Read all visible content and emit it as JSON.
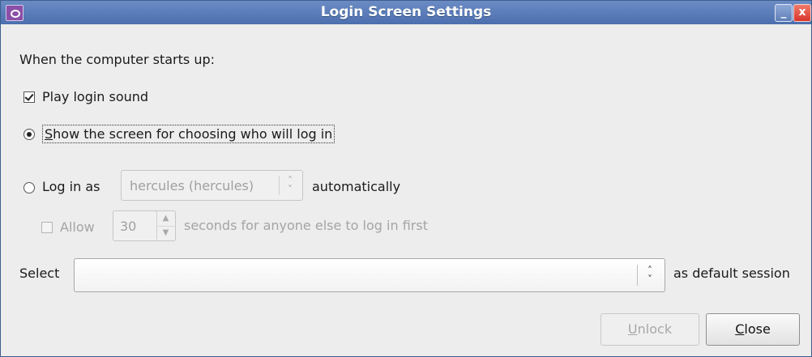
{
  "window": {
    "title": "Login Screen Settings",
    "minimize_glyph": "_",
    "close_glyph": "x",
    "app_icon": "login-settings-icon"
  },
  "intro": "When the computer starts up:",
  "options": {
    "play_login_sound": {
      "label": "Play login sound",
      "checked": true
    },
    "show_chooser": {
      "mnemonic": "S",
      "label_rest": "how the screen for choosing who will log in",
      "selected": true
    },
    "login_as": {
      "label": "Log in as",
      "user_value": "hercules (hercules)",
      "suffix": "automatically",
      "selected": false
    },
    "allow": {
      "label": "Allow",
      "seconds_value": "30",
      "suffix": "seconds for anyone else to log in first",
      "checked": false
    }
  },
  "session": {
    "prefix": "Select",
    "value": "",
    "suffix": "as default session"
  },
  "buttons": {
    "unlock": {
      "mnemonic": "U",
      "rest": "nlock"
    },
    "close": {
      "mnemonic": "C",
      "rest": "lose"
    }
  },
  "colors": {
    "titlebar": "#4c6fae",
    "window_bg": "#ededed",
    "disabled_text": "#a4a4a4"
  }
}
